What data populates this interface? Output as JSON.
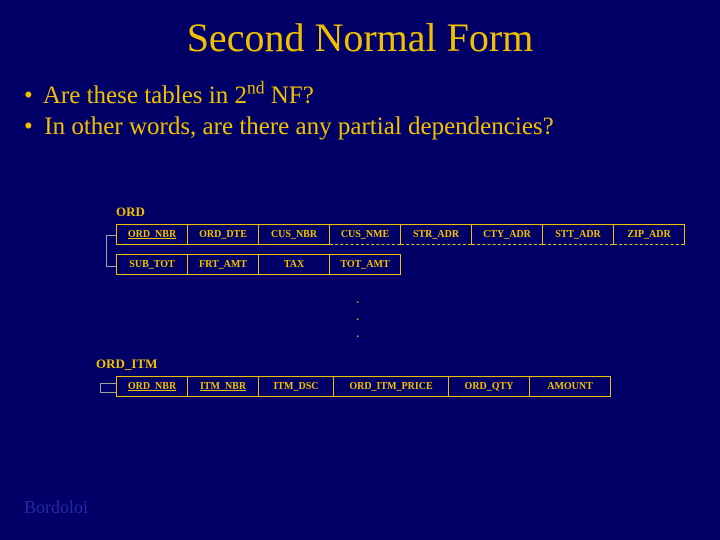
{
  "title": "Second Normal Form",
  "bullets": {
    "b1_pre": "Are these tables in 2",
    "b1_sup": "nd",
    "b1_post": " NF?",
    "b2": "In other words, are there any partial dependencies?"
  },
  "labels": {
    "ord": "ORD",
    "orditm": "ORD_ITM"
  },
  "ord_row1": {
    "c0": "ORD_NBR",
    "c1": "ORD_DTE",
    "c2": "CUS_NBR",
    "c3": "CUS_NME",
    "c4": "STR_ADR",
    "c5": "CTY_ADR",
    "c6": "STT_ADR",
    "c7": "ZIP_ADR"
  },
  "ord_row2": {
    "c0": "SUB_TOT",
    "c1": "FRT_AMT",
    "c2": "TAX",
    "c3": "TOT_AMT"
  },
  "orditm_row": {
    "c0": "ORD_NBR",
    "c1": "ITM_NBR",
    "c2": "ITM_DSC",
    "c3": "ORD_ITM_PRICE",
    "c4": "ORD_QTY",
    "c5": "AMOUNT"
  },
  "dots": {
    "d": "."
  },
  "footer": {
    "author": "Bordoloi"
  }
}
